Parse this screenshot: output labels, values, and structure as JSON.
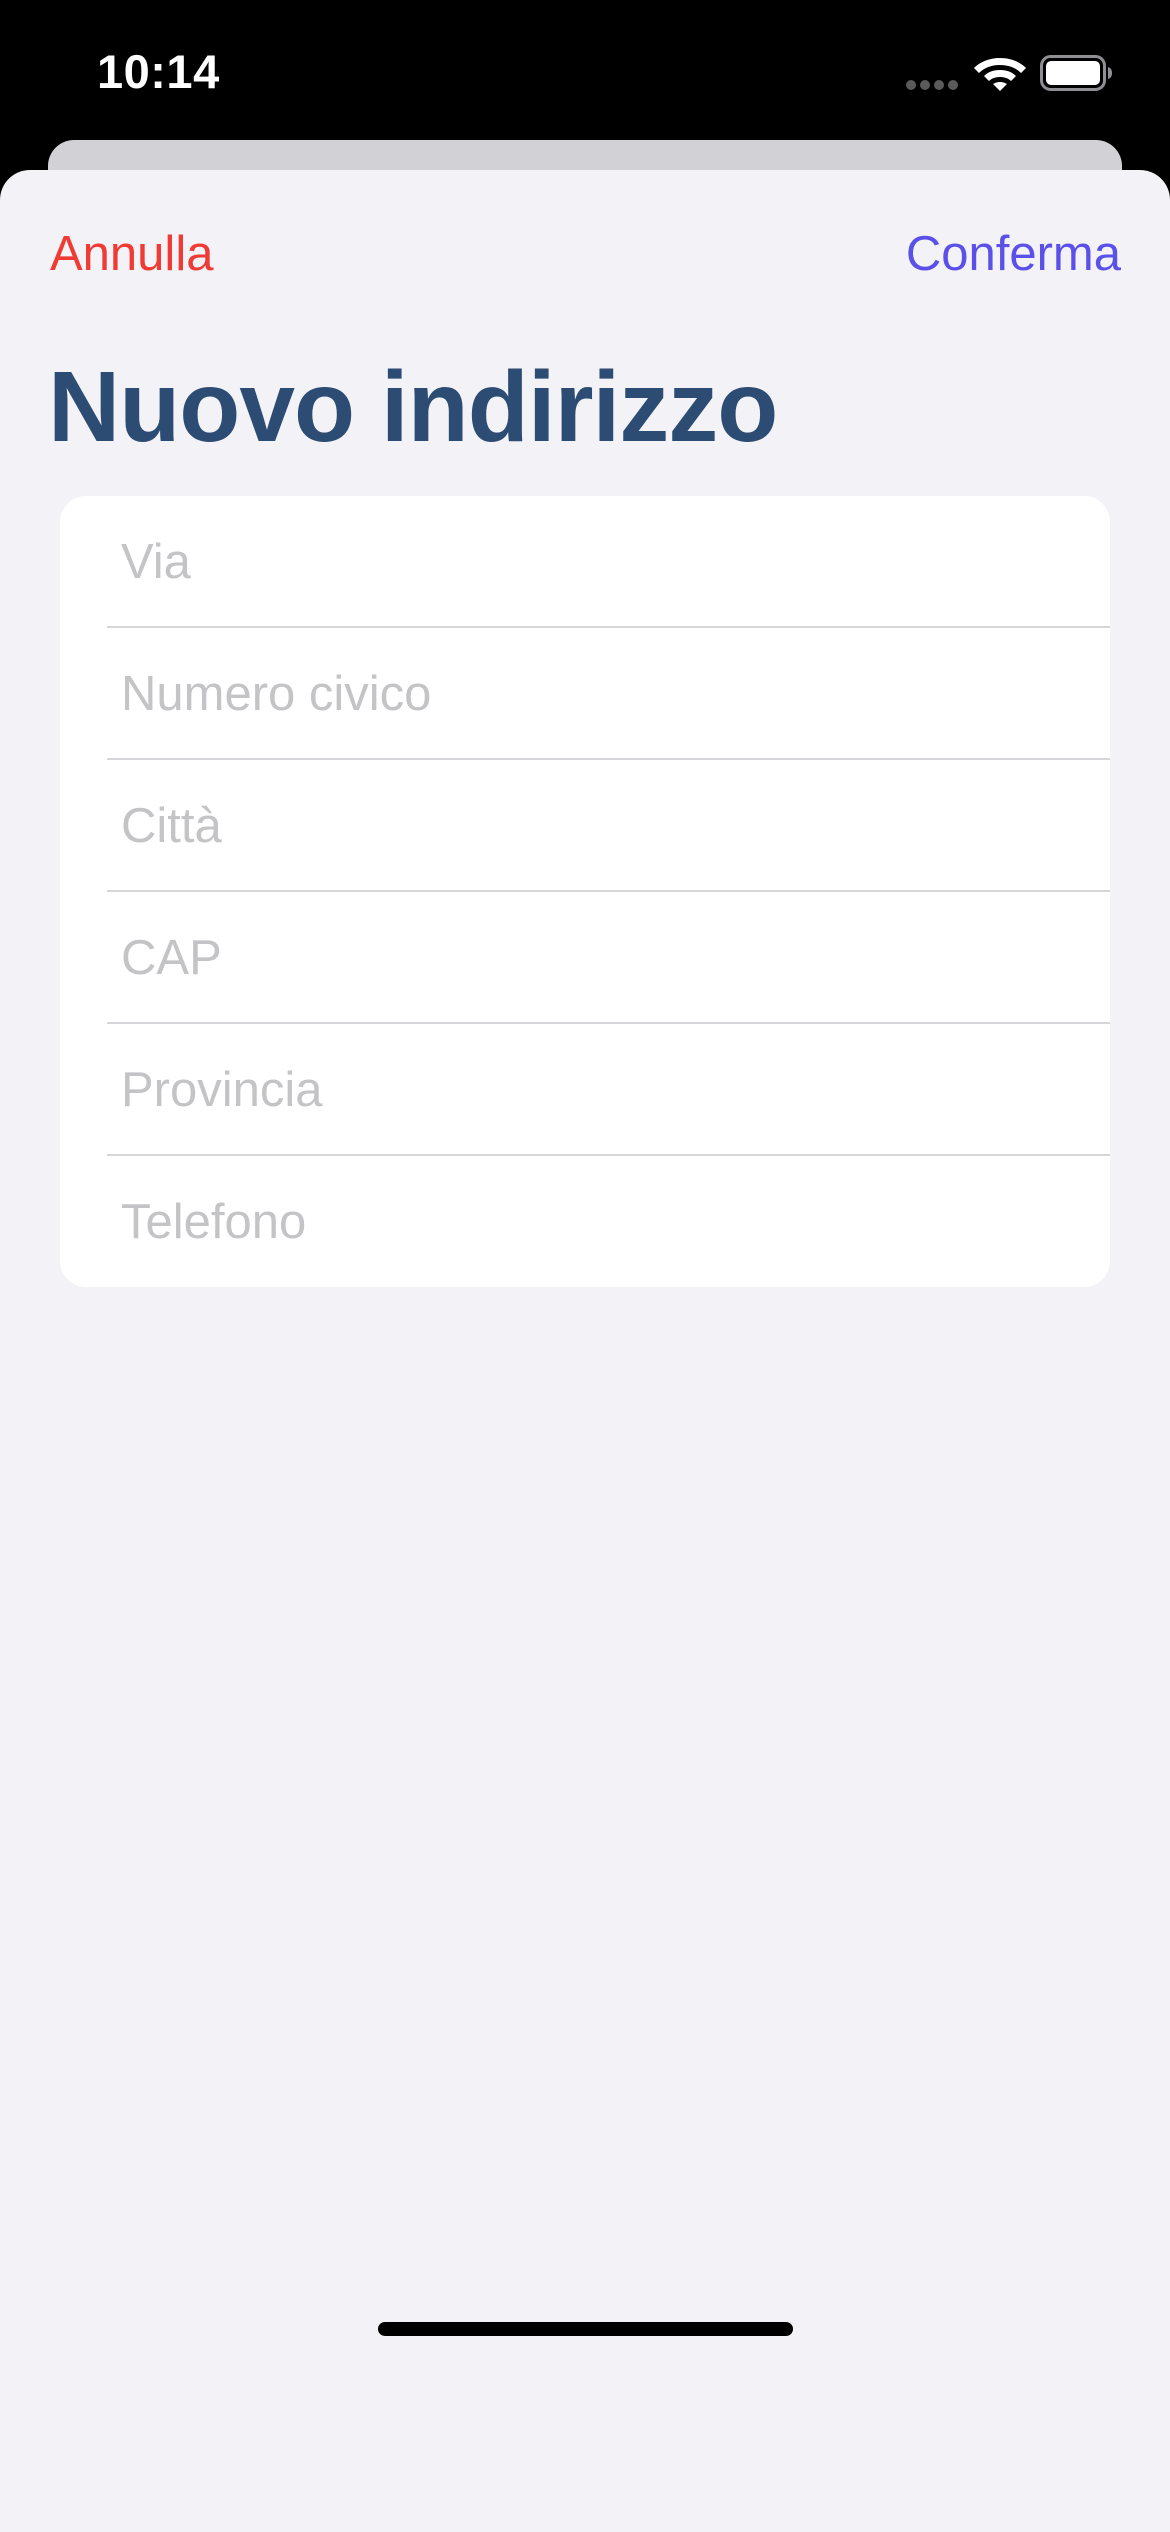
{
  "status_bar": {
    "time": "10:14",
    "icons": [
      "cellular-signal-icon",
      "wifi-icon",
      "battery-icon"
    ]
  },
  "navigation": {
    "cancel_label": "Annulla",
    "confirm_label": "Conferma"
  },
  "page": {
    "title": "Nuovo indirizzo"
  },
  "form": {
    "fields": [
      {
        "name": "via",
        "placeholder": "Via",
        "value": ""
      },
      {
        "name": "numero-civico",
        "placeholder": "Numero civico",
        "value": ""
      },
      {
        "name": "citta",
        "placeholder": "Città",
        "value": ""
      },
      {
        "name": "cap",
        "placeholder": "CAP",
        "value": ""
      },
      {
        "name": "provincia",
        "placeholder": "Provincia",
        "value": ""
      },
      {
        "name": "telefono",
        "placeholder": "Telefono",
        "value": ""
      }
    ]
  },
  "colors": {
    "cancel": "#ef3b33",
    "confirm": "#5b50e8",
    "title": "#2d4c74",
    "sheet_background": "#f2f2f7",
    "placeholder": "#c4c4c7"
  }
}
